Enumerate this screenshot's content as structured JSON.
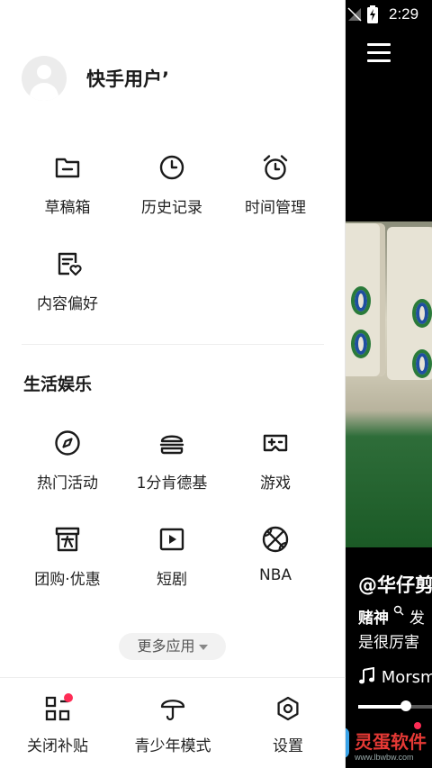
{
  "status_bar": {
    "time": "2:29"
  },
  "user": {
    "name": "快手用户’"
  },
  "main_grid": [
    {
      "label": "草稿箱",
      "icon": "folder-icon"
    },
    {
      "label": "历史记录",
      "icon": "clock-icon"
    },
    {
      "label": "时间管理",
      "icon": "alarm-icon"
    },
    {
      "label": "内容偏好",
      "icon": "content-preference-icon"
    }
  ],
  "section": {
    "title": "生活娱乐"
  },
  "life_grid": [
    {
      "label": "热门活动",
      "icon": "compass-icon"
    },
    {
      "label": "1分肯德基",
      "icon": "burger-icon"
    },
    {
      "label": "游戏",
      "icon": "gamepad-icon"
    },
    {
      "label": "团购·优惠",
      "icon": "group-buy-icon"
    },
    {
      "label": "短剧",
      "icon": "play-icon"
    },
    {
      "label": "NBA",
      "icon": "basketball-icon"
    }
  ],
  "more_apps": {
    "label": "更多应用"
  },
  "bottom_bar": [
    {
      "label": "关闭补贴",
      "icon": "subsidy-icon",
      "badge": true
    },
    {
      "label": "青少年模式",
      "icon": "umbrella-icon",
      "badge": false
    },
    {
      "label": "设置",
      "icon": "settings-icon",
      "badge": false
    }
  ],
  "video": {
    "author": "@华仔剪",
    "desc_tag": "赌神",
    "desc_rest": "发",
    "desc_line2": "是很厉害",
    "music": "Morsm",
    "progress": 0.65
  },
  "watermark": {
    "name": "灵蛋软件",
    "url": "www.lbwbw.com",
    "badge": "B"
  },
  "colors": {
    "accent": "#fe2c55",
    "text": "#222222",
    "icon": "#1a1a1a"
  }
}
